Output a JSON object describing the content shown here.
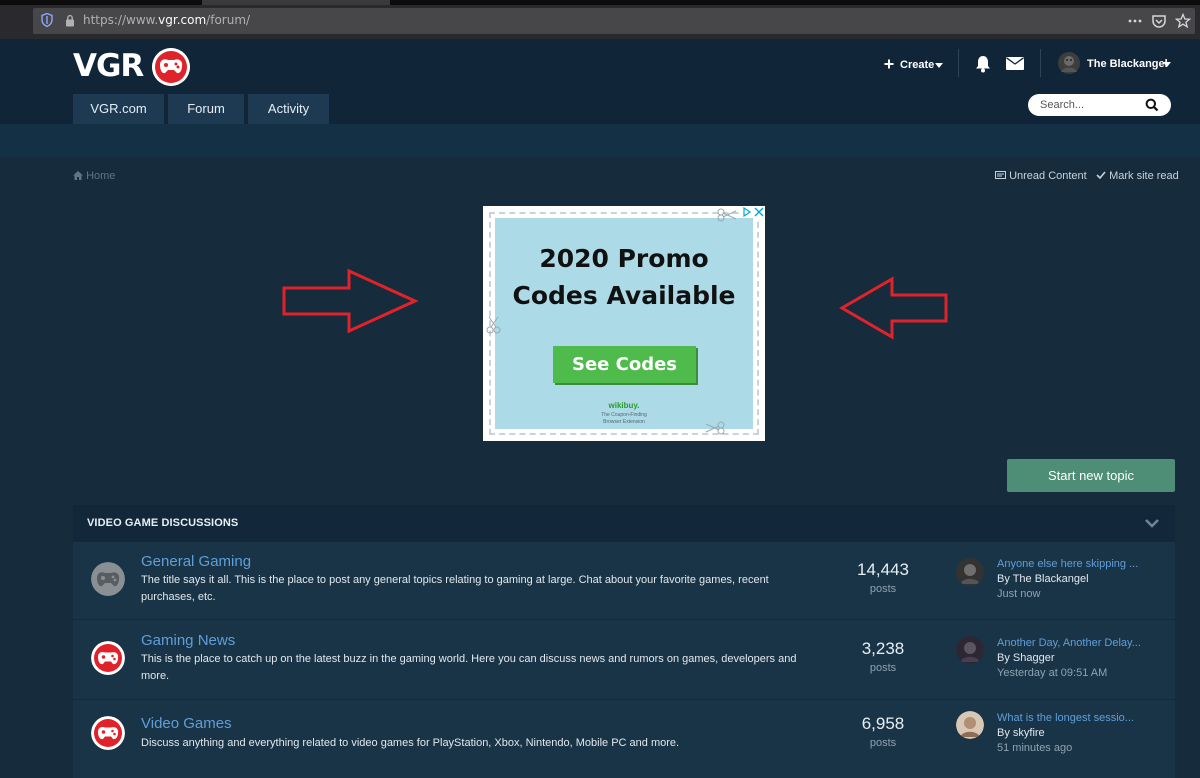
{
  "browser": {
    "url_prefix": "https://www.",
    "url_domain": "vgr.com",
    "url_path": "/forum/"
  },
  "header": {
    "logo_text": "VGR",
    "nav": [
      "VGR.com",
      "Forum",
      "Activity"
    ],
    "create_label": "Create",
    "username": "The Blackangel",
    "search_placeholder": "Search..."
  },
  "breadcrumb": {
    "home": "Home",
    "unread": "Unread Content",
    "mark_read": "Mark site read"
  },
  "ad": {
    "title_line1": "2020 Promo",
    "title_line2": "Codes Available",
    "button": "See Codes",
    "brand": "wikibuy.",
    "tagline_line1": "The Coupon-Finding",
    "tagline_line2": "Browser Extension"
  },
  "actions": {
    "start_topic": "Start new topic"
  },
  "category": {
    "title": "VIDEO GAME DISCUSSIONS",
    "forums": [
      {
        "title": "General Gaming",
        "description": "The title says it all. This is the place to post any general topics relating to gaming at large. Chat about your favorite games, recent purchases, etc.",
        "posts": "14,443",
        "posts_label": "posts",
        "last_title": "Anyone else here skipping ...",
        "last_by": "By The Blackangel",
        "last_time": "Just now"
      },
      {
        "title": "Gaming News",
        "description": "This is the place to catch up on the latest buzz in the gaming world. Here you can discuss news and rumors on games, developers and more.",
        "posts": "3,238",
        "posts_label": "posts",
        "last_title": "Another Day, Another Delay...",
        "last_by": "By Shagger",
        "last_time": "Yesterday at 09:51 AM"
      },
      {
        "title": "Video Games",
        "description": "Discuss anything and everything related to video games for PlayStation, Xbox, Nintendo, Mobile PC and more.",
        "posts": "6,958",
        "posts_label": "posts",
        "last_title": "What is the longest sessio...",
        "last_by": "By skyfire",
        "last_time": "51 minutes ago"
      }
    ]
  },
  "colors": {
    "page_bg": "#162b3c",
    "link": "#5f9fd9",
    "start_btn": "#4e8d76",
    "arrow": "#e0232a",
    "logo_red": "#e0232a"
  },
  "icons": [
    "shield-icon",
    "lock-icon",
    "more-icon",
    "pocket-icon",
    "star-icon",
    "plus-icon",
    "caret-down-icon",
    "bell-icon",
    "envelope-icon",
    "search-icon",
    "home-icon",
    "unread-icon",
    "check-icon",
    "chevron-down-icon",
    "gamepad-icon"
  ]
}
